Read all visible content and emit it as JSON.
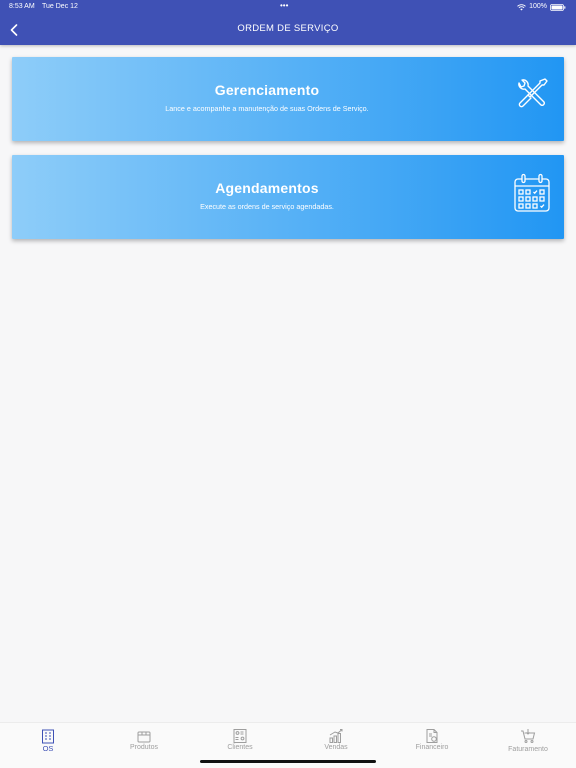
{
  "status_bar": {
    "time": "8:53 AM",
    "date": "Tue Dec 12",
    "dots": "•••",
    "battery": "100%"
  },
  "header": {
    "title": "ORDEM DE SERVIÇO",
    "back_icon": "chevron-left-icon"
  },
  "cards": [
    {
      "title": "Gerenciamento",
      "description": "Lance e acompanhe a manutenção de suas Ordens de Serviço.",
      "icon": "tools-icon"
    },
    {
      "title": "Agendamentos",
      "description": "Execute as ordens de serviço agendadas.",
      "icon": "calendar-icon"
    }
  ],
  "tabs": [
    {
      "label": "OS",
      "icon": "building-icon",
      "active": true
    },
    {
      "label": "Produtos",
      "icon": "box-icon",
      "active": false
    },
    {
      "label": "Clientes",
      "icon": "clients-icon",
      "active": false
    },
    {
      "label": "Vendas",
      "icon": "sales-chart-icon",
      "active": false
    },
    {
      "label": "Financeiro",
      "icon": "finance-icon",
      "active": false
    },
    {
      "label": "Faturamento",
      "icon": "cart-icon",
      "active": false
    }
  ],
  "colors": {
    "header": "#3f51b5",
    "card_gradient_start": "#8ecdf9",
    "card_gradient_end": "#2196f3",
    "tab_active": "#3f51b5",
    "tab_inactive": "#9e9e9e"
  }
}
